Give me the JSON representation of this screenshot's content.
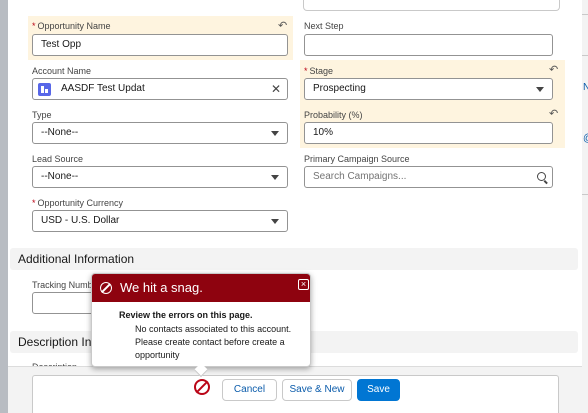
{
  "form": {
    "opportunity_name": {
      "label": "Opportunity Name",
      "required": "*",
      "value": "Test Opp"
    },
    "next_step": {
      "label": "Next Step",
      "value": ""
    },
    "account_name": {
      "label": "Account Name",
      "value": "AASDF Test Updat"
    },
    "stage": {
      "label": "Stage",
      "required": "*",
      "value": "Prospecting"
    },
    "type": {
      "label": "Type",
      "value": "--None--"
    },
    "probability": {
      "label": "Probability (%)",
      "value": "10%"
    },
    "lead_source": {
      "label": "Lead Source",
      "value": "--None--"
    },
    "primary_campaign_source": {
      "label": "Primary Campaign Source",
      "placeholder": "Search Campaigns..."
    },
    "opportunity_currency": {
      "label": "Opportunity Currency",
      "required": "*",
      "value": "USD - U.S. Dollar"
    }
  },
  "sections": {
    "additional_information": "Additional Information",
    "description_information": "Description Inf",
    "tracking_label": "Tracking Numb",
    "description_label": "Description"
  },
  "error_popover": {
    "title": "We hit a snag.",
    "body_title": "Review the errors on this page.",
    "errors": [
      "No contacts associated to this account.",
      "Please create contact before create a opportunity"
    ]
  },
  "footer": {
    "cancel_label": "Cancel",
    "save_new_label": "Save & New",
    "save_label": "Save"
  },
  "backdrop": {
    "link_fragment_1": "N",
    "link_fragment_2": "@"
  },
  "icons": {
    "undo": "undo-icon",
    "chevron": "chevron-down-icon",
    "search": "search-icon",
    "account": "account-icon",
    "error": "error-icon",
    "close": "close-icon"
  },
  "colors": {
    "highlight": "#fef4df",
    "error_header": "#8e030f",
    "brand": "#0176d3",
    "required": "#ba0517"
  }
}
